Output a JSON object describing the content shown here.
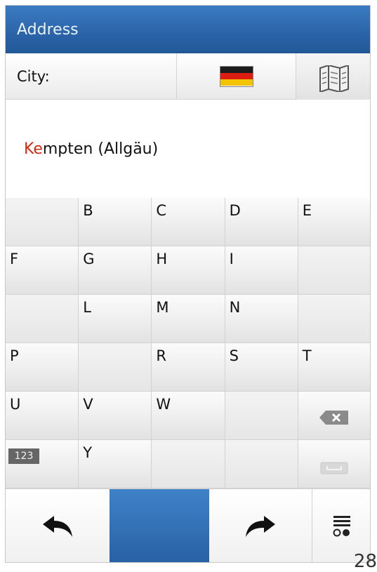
{
  "title_bar": {
    "title": "Address"
  },
  "field": {
    "label": "City:",
    "country_flag": "germany-flag",
    "map_icon": "map-icon"
  },
  "colors": {
    "accent_blue": "#2a63a8",
    "highlight_red": "#d22a15",
    "flag_black": "#1b1b1b",
    "flag_red": "#dd1d12",
    "flag_gold": "#f3c200"
  },
  "result": {
    "typed": "Ke",
    "completion": "mpten (Allgäu)"
  },
  "keyboard": {
    "rows": [
      [
        "",
        "B",
        "C",
        "D",
        "E"
      ],
      [
        "F",
        "G",
        "H",
        "I",
        ""
      ],
      [
        "",
        "L",
        "M",
        "N",
        ""
      ],
      [
        "P",
        "",
        "R",
        "S",
        "T"
      ],
      [
        "U",
        "V",
        "W",
        "",
        "⌫"
      ],
      [
        "123",
        "Y",
        "",
        "",
        "space"
      ]
    ],
    "numeric_label": "123",
    "backspace_icon": "backspace-icon",
    "space_icon": "space-bar-icon"
  },
  "bottom_bar": {
    "back_icon": "back-arrow-icon",
    "forward_icon": "forward-arrow-icon",
    "options_icon": "list-options-icon"
  },
  "page_number": "28"
}
